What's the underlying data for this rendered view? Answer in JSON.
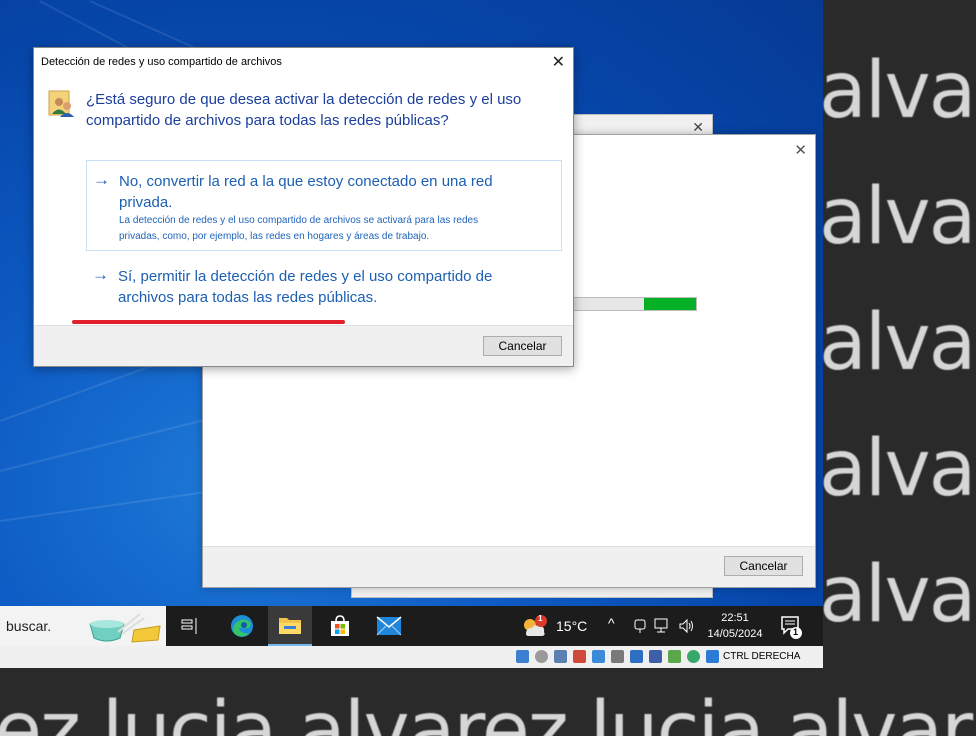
{
  "dialog": {
    "title": "Detección de redes y uso compartido de archivos",
    "close_glyph": "✕",
    "icon": "network-users-icon",
    "question": "¿Está seguro de que desea activar la detección de redes y el uso compartido de archivos para todas las redes públicas?",
    "option1": {
      "arrow": "→",
      "line1": "No, convertir la red a la que estoy conectado en una red",
      "line2": "privada.",
      "desc1": "La detección de redes y el uso compartido de archivos se activará para las redes",
      "desc2": "privadas, como, por ejemplo, las redes en hogares y áreas de trabajo."
    },
    "option2": {
      "arrow": "→",
      "line1": "Sí, permitir la detección de redes y el uso compartido de",
      "line2": "archivos para todas las redes públicas."
    },
    "cancel_label": "Cancelar"
  },
  "background_window": {
    "close_glyph": "✕",
    "progress": 0.43,
    "cancel_label": "Cancelar"
  },
  "back_window": {
    "close_glyph": "✕"
  },
  "taskbar": {
    "search_text": "buscar.",
    "weather_badge": "1",
    "temperature": "15°C",
    "time": "22:51",
    "date": "14/05/2024",
    "notification_badge": "1",
    "tray_chevron": "^"
  },
  "statusbar": {
    "host_key": "CTRL DERECHA"
  },
  "watermark": {
    "word": "alvar",
    "bottom": "ez lucia alvarez lucia alvar"
  },
  "colors": {
    "link_blue": "#1c5fb2",
    "highlight_red": "#e0202a",
    "progress_green": "#06b025"
  }
}
